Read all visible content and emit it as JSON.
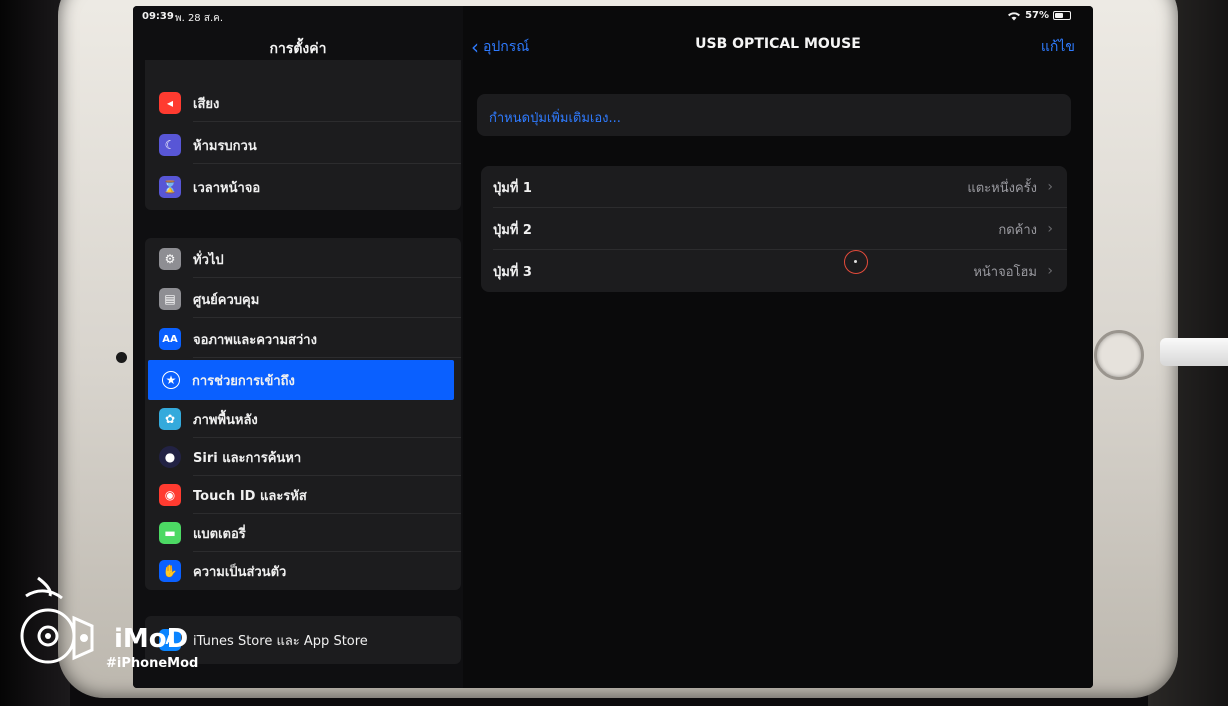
{
  "status_bar": {
    "time": "09:39",
    "date": "พ. 28 ส.ค.",
    "battery": "57%",
    "battery_level": 0.57
  },
  "sidebar": {
    "title": "การตั้งค่า",
    "group1": [
      {
        "label": "เสียง",
        "icon": "speaker-icon",
        "color": "#ff3b30"
      },
      {
        "label": "ห้ามรบกวน",
        "icon": "moon-icon",
        "color": "#5856d6"
      },
      {
        "label": "เวลาหน้าจอ",
        "icon": "hourglass-icon",
        "color": "#5856d6"
      }
    ],
    "group2": [
      {
        "label": "ทั่วไป",
        "icon": "gear-icon",
        "color": "#8e8e93"
      },
      {
        "label": "ศูนย์ควบคุม",
        "icon": "control-center-icon",
        "color": "#8e8e93"
      },
      {
        "label": "จอภาพและความสว่าง",
        "icon": "text-size-icon",
        "color": "#0a60ff"
      },
      {
        "label": "การช่วยการเข้าถึง",
        "icon": "accessibility-icon",
        "color": "#0a60ff",
        "selected": true
      },
      {
        "label": "ภาพพื้นหลัง",
        "icon": "wallpaper-icon",
        "color": "#34aadc"
      },
      {
        "label": "Siri และการค้นหา",
        "icon": "siri-icon",
        "color": "#222244"
      },
      {
        "label": "Touch ID และรหัส",
        "icon": "fingerprint-icon",
        "color": "#ff3b30"
      },
      {
        "label": "แบตเตอรี่",
        "icon": "battery-icon",
        "color": "#4cd964"
      },
      {
        "label": "ความเป็นส่วนตัว",
        "icon": "hand-icon",
        "color": "#0a60ff"
      }
    ],
    "group3": [
      {
        "label": "iTunes Store และ App Store",
        "icon": "app-store-icon",
        "color": "#0a84ff"
      }
    ]
  },
  "detail": {
    "back_label": "อุปกรณ์",
    "title": "USB OPTICAL MOUSE",
    "edit_label": "แก้ไข",
    "customize_link": "กำหนดปุ่มเพิ่มเติมเอง...",
    "buttons": [
      {
        "label": "ปุ่มที่ 1",
        "value": "แตะหนึ่งครั้ง"
      },
      {
        "label": "ปุ่มที่ 2",
        "value": "กดค้าง"
      },
      {
        "label": "ปุ่มที่ 3",
        "value": "หน้าจอโฮม"
      }
    ]
  },
  "watermark": {
    "brand": "iMoD",
    "tag": "#iPhoneMod"
  }
}
